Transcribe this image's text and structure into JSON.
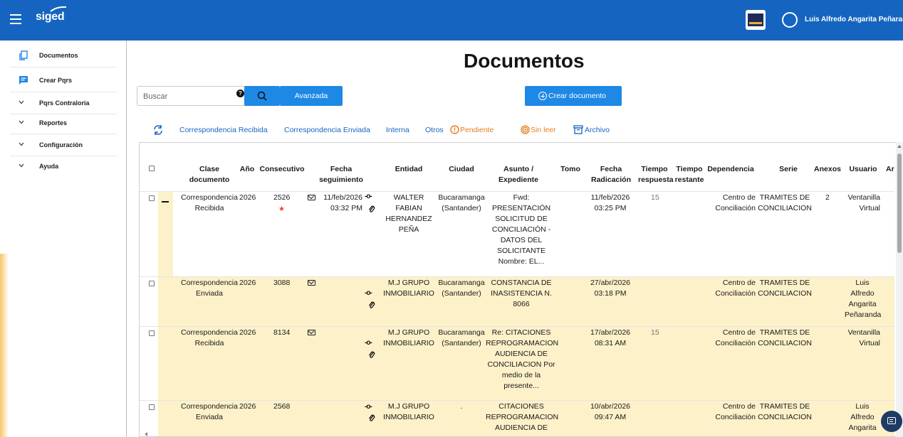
{
  "topbar": {
    "app_name": "siged",
    "user_name": "Luis Alfredo Angarita Peñaranda",
    "accent": "#1565c0"
  },
  "sidebar": {
    "items": [
      {
        "label": "Documentos",
        "icon": "documents-icon"
      },
      {
        "label": "Crear Pqrs",
        "icon": "chat-form-icon"
      },
      {
        "label": "Pqrs Contraloria",
        "icon": "chevron-down-icon"
      },
      {
        "label": "Reportes",
        "icon": "chevron-down-icon"
      },
      {
        "label": "Configuración",
        "icon": "chevron-down-icon"
      },
      {
        "label": "Ayuda",
        "icon": "chevron-down-icon"
      }
    ]
  },
  "main": {
    "title": "Documentos",
    "search_placeholder": "Buscar",
    "advanced_label": "Avanzada",
    "create_label": "Crear documento"
  },
  "filters": {
    "recibida": "Correspondencia Recibida",
    "enviada": "Correspondencia Enviada",
    "interna": "Interna",
    "otros": "Otros",
    "pendiente": "Pendiente",
    "sin_leer": "Sin leer",
    "archivo": "Archivo"
  },
  "table": {
    "headers": {
      "clase": "Clase documento",
      "anio": "Año",
      "consecutivo": "Consecutivo",
      "fecha_seg": "Fecha seguimiento",
      "entidad": "Entidad",
      "ciudad": "Ciudad",
      "asunto": "Asunto / Expediente",
      "tomo": "Tomo",
      "fecha_rad": "Fecha Radicación",
      "t_resp": "Tiempo respuesta",
      "t_rest": "Tiempo restante",
      "dependencia": "Dependencia",
      "serie": "Serie",
      "anexos": "Anexos",
      "usuario": "Usuario",
      "ar": "Ar"
    },
    "rows": [
      {
        "clase": "Correspondencia Recibida",
        "anio": "2026",
        "consecutivo": "2526",
        "fecha_seg": "11/feb/2026 03:32 PM",
        "entidad": "WALTER FABIAN HERNANDEZ PEÑA",
        "ciudad": "Bucaramanga (Santander)",
        "asunto": "Fwd: PRESENTACIÓN SOLICITUD DE CONCILIACIÓN - DATOS DEL SOLICITANTE Nombre: EL...",
        "fecha_rad": "11/feb/2026 03:25 PM",
        "t_resp": "15",
        "dependencia": "Centro de Conciliación",
        "serie": "TRAMITES DE CONCILIACION",
        "anexos": "2",
        "usuario": "Ventanilla Virtual"
      },
      {
        "clase": "Correspondencia Enviada",
        "anio": "2026",
        "consecutivo": "3088",
        "entidad": "M.J GRUPO INMOBILIARIO",
        "ciudad": "Bucaramanga (Santander)",
        "asunto": "CONSTANCIA DE INASISTENCIA N. 8066",
        "fecha_rad": "27/abr/2026 03:18 PM",
        "dependencia": "Centro de Conciliación",
        "serie": "TRAMITES DE CONCILIACION",
        "usuario": "Luis Alfredo Angarita Peñaranda"
      },
      {
        "clase": "Correspondencia Recibida",
        "anio": "2026",
        "consecutivo": "8134",
        "entidad": "M.J GRUPO INMOBILIARIO",
        "ciudad": "Bucaramanga (Santander)",
        "asunto": "Re: CITACIONES REPROGRAMACION AUDIENCIA DE CONCILIACION Por medio de la presente...",
        "fecha_rad": "17/abr/2026 08:31 AM",
        "t_resp": "15",
        "dependencia": "Centro de Conciliación",
        "serie": "TRAMITES DE CONCILIACION",
        "usuario": "Ventanilla Virtual"
      },
      {
        "clase": "Correspondencia Enviada",
        "anio": "2026",
        "consecutivo": "2568",
        "entidad": "M.J GRUPO INMOBILIARIO",
        "ciudad": ".",
        "asunto": "CITACIONES REPROGRAMACION AUDIENCIA DE",
        "fecha_rad": "10/abr/2026 09:47 AM",
        "dependencia": "Centro de Conciliación",
        "serie": "TRAMITES DE CONCILIACION",
        "usuario": "Luis Alfredo Angarita"
      }
    ]
  }
}
